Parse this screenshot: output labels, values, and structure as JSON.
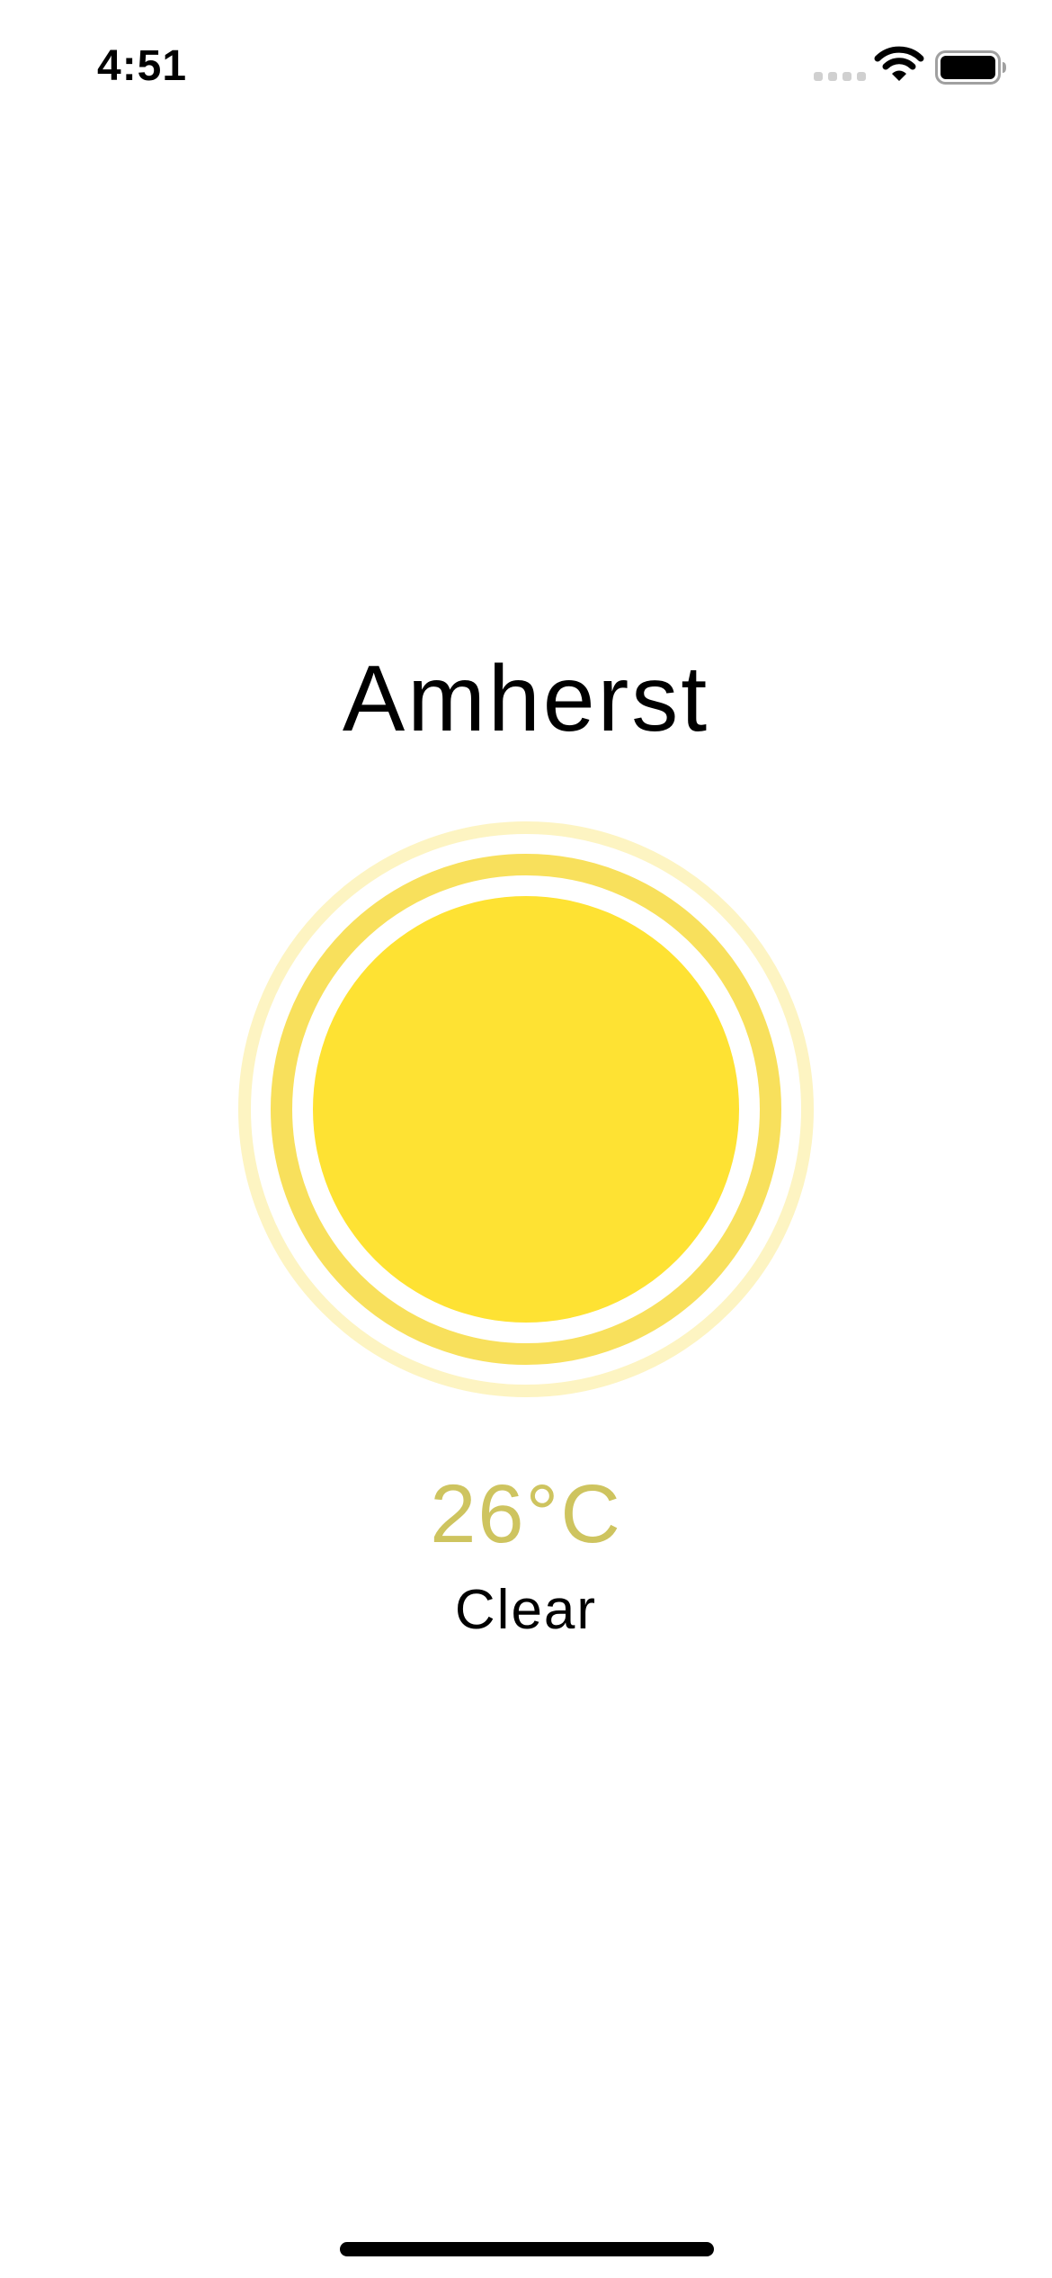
{
  "status_bar": {
    "time": "4:51",
    "icons": [
      "cellular-signal-icon",
      "wifi-icon",
      "battery-icon"
    ]
  },
  "weather": {
    "city": "Amherst",
    "temperature": "26°C",
    "condition": "Clear",
    "icon": "sun-icon"
  },
  "colors": {
    "sun_core": "#FEE233",
    "sun_ring_inner": "#F8E05C",
    "sun_ring_outer": "#FDF4C2",
    "temperature_text": "#CEC45F",
    "text": "#000000",
    "background": "#FFFFFF"
  }
}
